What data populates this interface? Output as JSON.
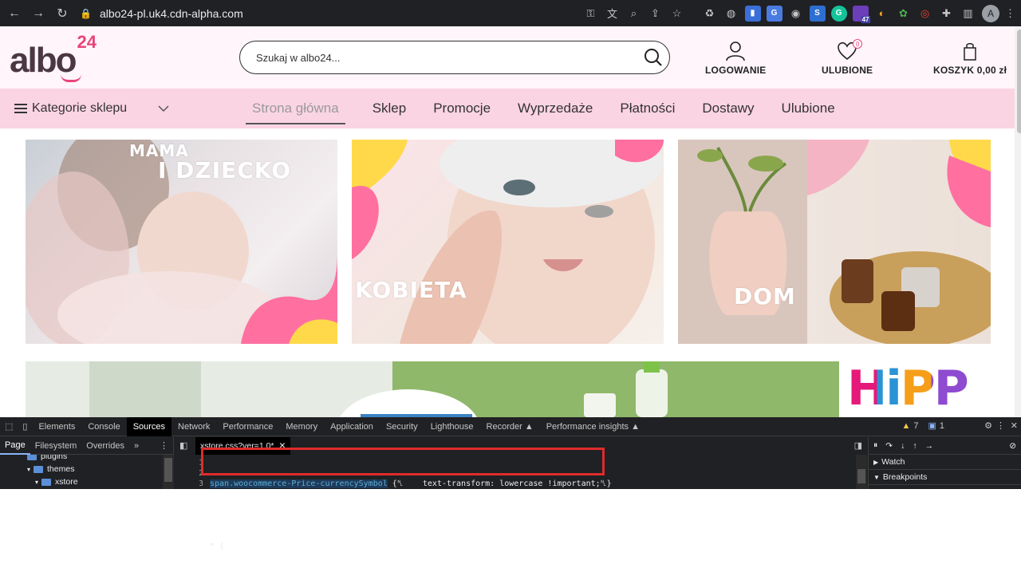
{
  "browser": {
    "url": "albo24-pl.uk4.cdn-alpha.com",
    "extension_badge": "47",
    "profile_initial": "A"
  },
  "site": {
    "logo_text": "albo",
    "logo_sup": "24",
    "search_placeholder": "Szukaj w albo24...",
    "account_label": "LOGOWANIE",
    "wishlist_label": "ULUBIONE",
    "wishlist_count": "0",
    "cart_label": "KOSZYK 0,00 zł",
    "categories_label": "Kategorie sklepu",
    "menu": [
      "Strona główna",
      "Sklep",
      "Promocje",
      "Wyprzedaże",
      "Płatności",
      "Dostawy",
      "Ulubione"
    ],
    "banners": [
      {
        "title_line1": "MAMA",
        "title_line2": "I DZIECKO"
      },
      {
        "title_line1": "KOBIETA",
        "title_line2": ""
      },
      {
        "title_line1": "DOM",
        "title_line2": ""
      }
    ],
    "hipp_text": "HiPP"
  },
  "devtools": {
    "tabs": [
      "Elements",
      "Console",
      "Sources",
      "Network",
      "Performance",
      "Memory",
      "Application",
      "Security",
      "Lighthouse",
      "Recorder ▲",
      "Performance insights ▲"
    ],
    "active_tab": "Sources",
    "warnings": "7",
    "messages": "1",
    "subtabs": [
      "Page",
      "Filesystem",
      "Overrides"
    ],
    "tree": [
      "plugins",
      "themes",
      "xstore"
    ],
    "file_tab": "xstore.css?ver=1.0*",
    "line_numbers": [
      "1",
      "2",
      "3"
    ],
    "code_line1_selector": "span.woocommerce-Price-currencySymbol",
    "code_line1_rest": " {␤    text-transform: lowercase !important;␤}",
    "code_line3": "* {",
    "watch_label": "Watch",
    "breakpoints_label": "Breakpoints"
  },
  "colors": {
    "header_bg": "#fff5fa",
    "nav_bg": "#fbd4e3",
    "brand_pink": "#e8457a",
    "devtools_bg": "#202124",
    "highlight_red": "#e02b2b"
  }
}
